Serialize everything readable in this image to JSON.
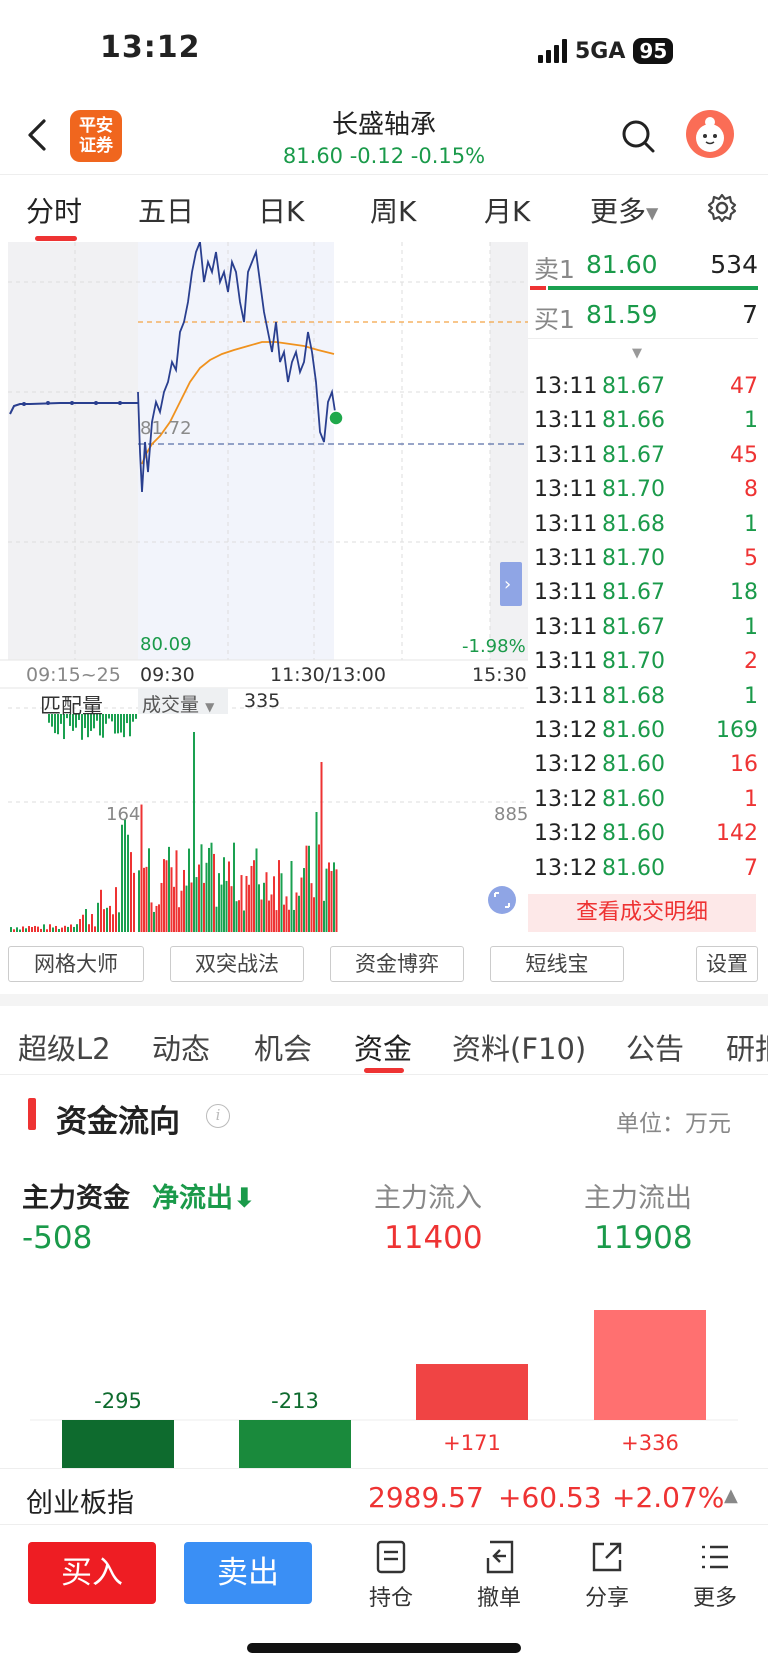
{
  "status": {
    "time": "13:12",
    "network": "5GA",
    "battery": "95"
  },
  "header": {
    "broker_logo": "平安证券",
    "stock_name": "长盛轴承",
    "price": "81.60",
    "change": "-0.12",
    "change_pct": "-0.15%"
  },
  "chart_tabs": [
    "分时",
    "五日",
    "日K",
    "周K",
    "月K",
    "更多"
  ],
  "chart_labels": {
    "avg_price_tag": "81.72",
    "low_price": "80.09",
    "low_pct": "-1.98%",
    "time_auction": "09:15~25",
    "time_open": "09:30",
    "time_mid": "11:30/13:00",
    "time_close": "15:30",
    "match_volume_label": "匹配量",
    "volume_selector": "成交量",
    "volume_value": "335",
    "auction_max": "164",
    "volume_max": "885"
  },
  "orderbook": {
    "ask_label": "卖1",
    "ask_price": "81.60",
    "ask_vol": "534",
    "bid_label": "买1",
    "bid_price": "81.59",
    "bid_vol": "7"
  },
  "ticks": [
    {
      "time": "13:11",
      "price": "81.67",
      "vol": "47",
      "dir": "buy"
    },
    {
      "time": "13:11",
      "price": "81.66",
      "vol": "1",
      "dir": "sell"
    },
    {
      "time": "13:11",
      "price": "81.67",
      "vol": "45",
      "dir": "buy"
    },
    {
      "time": "13:11",
      "price": "81.70",
      "vol": "8",
      "dir": "buy"
    },
    {
      "time": "13:11",
      "price": "81.68",
      "vol": "1",
      "dir": "sell"
    },
    {
      "time": "13:11",
      "price": "81.70",
      "vol": "5",
      "dir": "buy"
    },
    {
      "time": "13:11",
      "price": "81.67",
      "vol": "18",
      "dir": "sell"
    },
    {
      "time": "13:11",
      "price": "81.67",
      "vol": "1",
      "dir": "sell"
    },
    {
      "time": "13:11",
      "price": "81.70",
      "vol": "2",
      "dir": "buy"
    },
    {
      "time": "13:11",
      "price": "81.68",
      "vol": "1",
      "dir": "sell"
    },
    {
      "time": "13:12",
      "price": "81.60",
      "vol": "169",
      "dir": "sell"
    },
    {
      "time": "13:12",
      "price": "81.60",
      "vol": "16",
      "dir": "buy"
    },
    {
      "time": "13:12",
      "price": "81.60",
      "vol": "1",
      "dir": "buy"
    },
    {
      "time": "13:12",
      "price": "81.60",
      "vol": "142",
      "dir": "buy"
    },
    {
      "time": "13:12",
      "price": "81.60",
      "vol": "7",
      "dir": "buy"
    }
  ],
  "deal_detail": "查看成交明细",
  "tool_buttons": [
    "网格大师",
    "双突战法",
    "资金博弈",
    "短线宝",
    "设置"
  ],
  "info_tabs": [
    "超级L2",
    "动态",
    "机会",
    "资金",
    "资料(F10)",
    "公告",
    "研报"
  ],
  "fund_flow": {
    "title": "资金流向",
    "unit": "单位：万元",
    "main_label": "主力资金",
    "net_label": "净流出",
    "net_value": "-508",
    "inflow_label": "主力流入",
    "inflow_value": "11400",
    "outflow_label": "主力流出",
    "outflow_value": "11908"
  },
  "chart_data": {
    "type": "bar",
    "values": [
      -295,
      -213,
      171,
      336
    ],
    "labels": [
      "-295",
      "-213",
      "+171",
      "+336"
    ]
  },
  "index": {
    "name": "创业板指",
    "value": "2989.57",
    "change": "+60.53",
    "change_pct": "+2.07%"
  },
  "bottom_bar": {
    "buy": "买入",
    "sell": "卖出",
    "items": [
      "持仓",
      "撤单",
      "分享",
      "更多"
    ]
  },
  "colors": {
    "up": "#ee3333",
    "down": "#1a9a4a",
    "price_line": "#2a3f8f",
    "avg_line": "#f0921e"
  }
}
